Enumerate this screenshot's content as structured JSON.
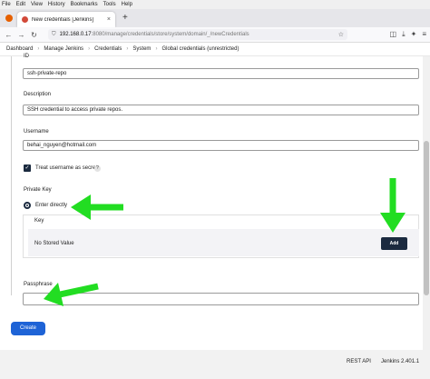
{
  "menubar": {
    "items": [
      "File",
      "Edit",
      "View",
      "History",
      "Bookmarks",
      "Tools",
      "Help"
    ]
  },
  "tab": {
    "title": "New credentials [Jenkins]",
    "close": "×"
  },
  "newtab": "+",
  "url": {
    "host": "192.168.0.17",
    "rest": ":8080/manage/credentials/store/system/domain/_/newCredentials"
  },
  "breadcrumb": [
    "Dashboard",
    "Manage Jenkins",
    "Credentials",
    "System",
    "Global credentials (unrestricted)"
  ],
  "form": {
    "id_label": "ID",
    "id_value": "ssh-private-repo",
    "description_label": "Description",
    "description_value": "SSH credential to access private repos.",
    "username_label": "Username",
    "username_value": "behai_nguyen@hotmail.com",
    "treat_secret_label": "Treat username as secret",
    "help_glyph": "?",
    "private_key_label": "Private Key",
    "enter_directly_label": "Enter directly",
    "key_label": "Key",
    "no_stored_value": "No Stored Value",
    "add_label": "Add",
    "passphrase_label": "Passphrase",
    "passphrase_value": "",
    "create_label": "Create"
  },
  "footer": {
    "rest_api": "REST API",
    "version": "Jenkins 2.401.1"
  },
  "colors": {
    "arrow": "#22dd22",
    "primary": "#1e63d6",
    "dark": "#1b2a3f"
  }
}
